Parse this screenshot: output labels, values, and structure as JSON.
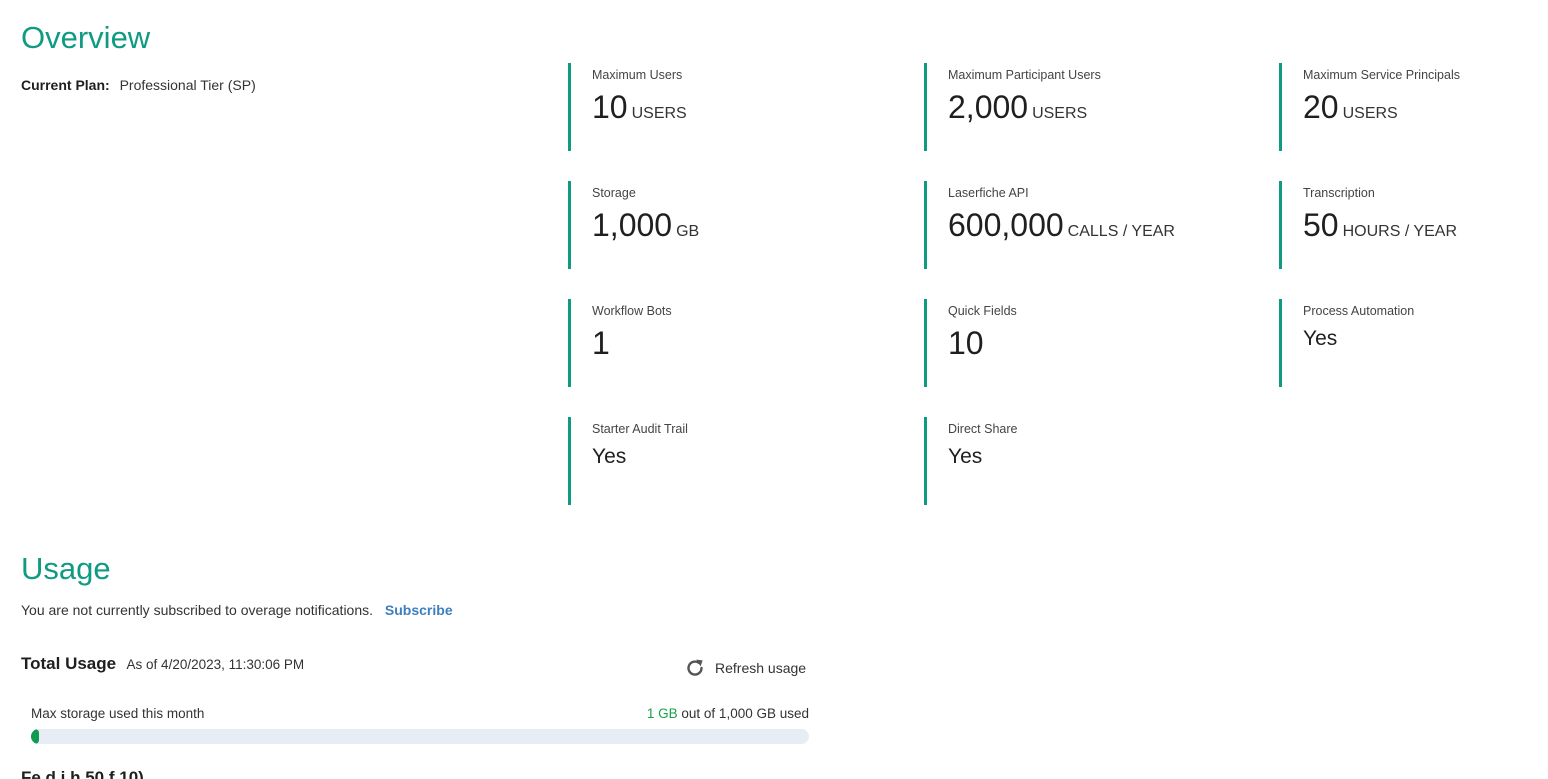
{
  "overview": {
    "title": "Overview",
    "current_plan_label": "Current Plan:",
    "current_plan_value": "Professional Tier (SP)",
    "tiles": [
      {
        "label": "Maximum Users",
        "value": "10",
        "unit": "USERS"
      },
      {
        "label": "Maximum Participant Users",
        "value": "2,000",
        "unit": "USERS"
      },
      {
        "label": "Maximum Service Principals",
        "value": "20",
        "unit": "USERS"
      },
      {
        "label": "Storage",
        "value": "1,000",
        "unit": "GB"
      },
      {
        "label": "Laserfiche API",
        "value": "600,000",
        "unit": "CALLS / YEAR"
      },
      {
        "label": "Transcription",
        "value": "50",
        "unit": "HOURS / YEAR"
      },
      {
        "label": "Workflow Bots",
        "value": "1"
      },
      {
        "label": "Quick Fields",
        "value": "10"
      },
      {
        "label": "Process Automation",
        "value": "Yes"
      },
      {
        "label": "Starter Audit Trail",
        "value": "Yes"
      },
      {
        "label": "Direct Share",
        "value": "Yes"
      }
    ]
  },
  "usage": {
    "title": "Usage",
    "overage_text": "You are not currently subscribed to overage notifications.",
    "subscribe_label": "Subscribe",
    "total_usage_title": "Total Usage",
    "as_of": "As of 4/20/2023, 11:30:06 PM",
    "refresh_label": "Refresh usage",
    "storage": {
      "label": "Max storage used this month",
      "used": "1 GB",
      "suffix": "out of 1,000 GB used",
      "fraction": 0.001
    },
    "next_section_partial": "Fe  d    i  h 50  f 10)"
  },
  "colors": {
    "accent": "#0f9b82",
    "link": "#3d7fbf",
    "progress": "#0f9b50",
    "track": "#e8edf5"
  },
  "icons": {
    "refresh": "refresh-icon"
  }
}
